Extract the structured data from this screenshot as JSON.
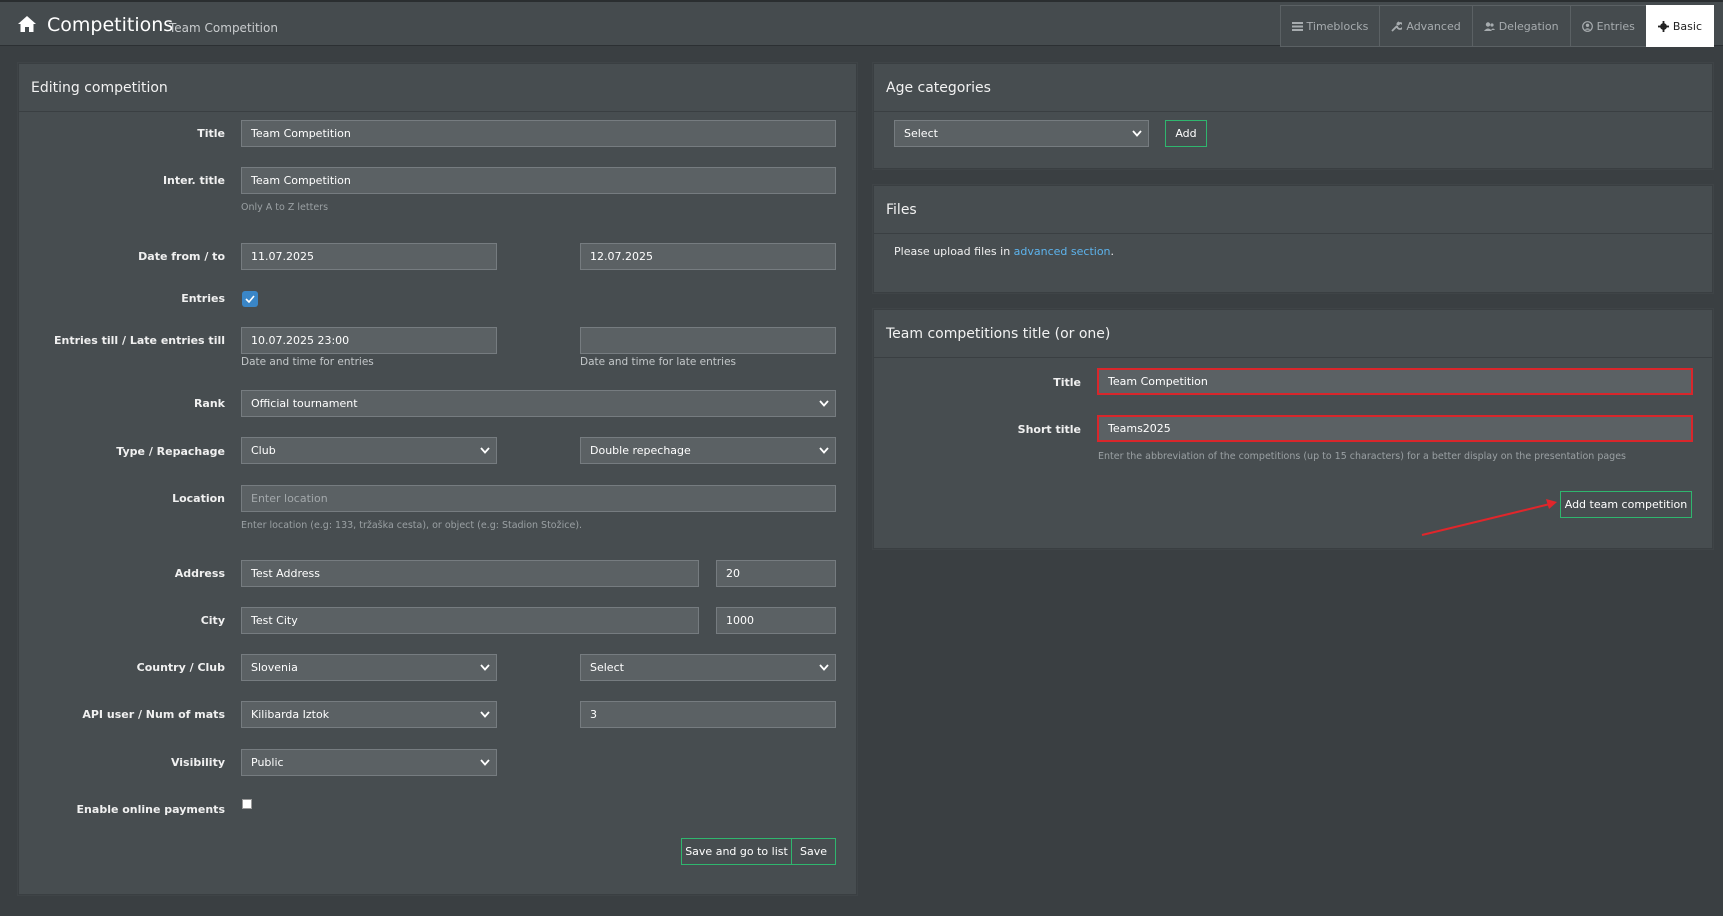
{
  "header": {
    "title": "Competitions",
    "subtitle": "Team Competition",
    "tabs": [
      {
        "label": "Timeblocks",
        "icon": "list-icon"
      },
      {
        "label": "Advanced",
        "icon": "wrench-icon"
      },
      {
        "label": "Delegation",
        "icon": "users-icon"
      },
      {
        "label": "Entries",
        "icon": "user-circle-icon"
      },
      {
        "label": "Basic",
        "icon": "gear-icon",
        "active": true
      }
    ]
  },
  "editing": {
    "heading": "Editing competition",
    "title_label": "Title",
    "title_value": "Team Competition",
    "inter_title_label": "Inter. title",
    "inter_title_value": "Team Competition",
    "inter_title_help": "Only A to Z letters",
    "date_label": "Date from / to",
    "date_from": "11.07.2025",
    "date_to": "12.07.2025",
    "entries_label": "Entries",
    "entries_checked": true,
    "entries_till_label": "Entries till / Late entries till",
    "entries_till_value": "10.07.2025 23:00",
    "late_entries_value": "",
    "entries_till_help": "Date and time for entries",
    "late_entries_help": "Date and time for late entries",
    "rank_label": "Rank",
    "rank_value": "Official tournament",
    "type_label": "Type / Repachage",
    "type_value": "Club",
    "repechage_value": "Double repechage",
    "location_label": "Location",
    "location_placeholder": "Enter location",
    "location_help": "Enter location (e.g: 133, tržaška cesta), or object (e.g: Stadion Stožice).",
    "address_label": "Address",
    "address_value": "Test Address",
    "address_number": "20",
    "city_label": "City",
    "city_value": "Test City",
    "postal_value": "1000",
    "country_label": "Country / Club",
    "country_value": "Slovenia",
    "club_value": "Select",
    "api_label": "API user / Num of mats",
    "api_user_value": "Kilibarda Iztok",
    "mats_value": "3",
    "visibility_label": "Visibility",
    "visibility_value": "Public",
    "payments_label": "Enable online payments",
    "payments_checked": false,
    "save_list_label": "Save and go to list",
    "save_label": "Save"
  },
  "age": {
    "heading": "Age categories",
    "select_value": "Select",
    "add_label": "Add"
  },
  "files": {
    "heading": "Files",
    "text_before": "Please upload files in ",
    "link_text": "advanced section",
    "text_after": "."
  },
  "team": {
    "heading": "Team competitions title (or one)",
    "title_label": "Title",
    "title_value": "Team Competition",
    "short_label": "Short title",
    "short_value": "Teams2025",
    "short_help": "Enter the abbreviation of the competitions (up to 15 characters) for a better display on the presentation pages",
    "add_label": "Add team competition"
  },
  "colors": {
    "background": "#3a3f42",
    "panel": "#474d50",
    "accent_green": "#2fb66e",
    "error_red": "#d9262b",
    "link_blue": "#5db3ec"
  }
}
